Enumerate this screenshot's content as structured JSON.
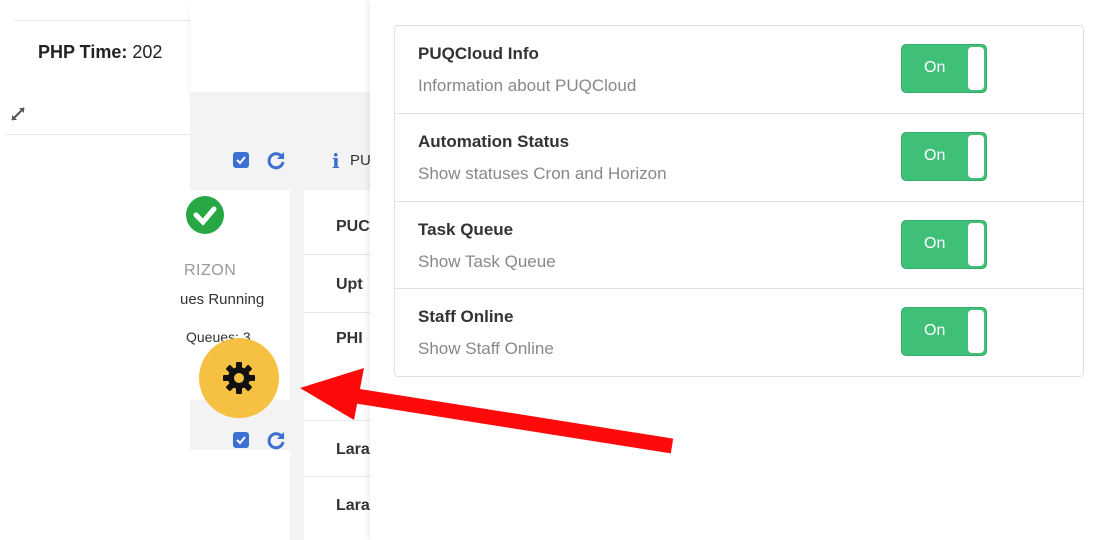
{
  "php_card": {
    "label": "PHP Time:",
    "value": "202"
  },
  "horizon_widget": {
    "status_title": "RIZON",
    "running_text": "ues Running",
    "queues_text": "Queues: 3"
  },
  "info_widget": {
    "header": "PU",
    "rows": [
      "PUC",
      "Upt",
      "PHI",
      "Lara",
      "Lara"
    ]
  },
  "settings": {
    "items": [
      {
        "title": "PUQCloud Info",
        "description": "Information about PUQCloud",
        "toggle": "On"
      },
      {
        "title": "Automation Status",
        "description": "Show statuses Cron and Horizon",
        "toggle": "On"
      },
      {
        "title": "Task Queue",
        "description": "Show Task Queue",
        "toggle": "On"
      },
      {
        "title": "Staff Online",
        "description": "Show Staff Online",
        "toggle": "On"
      }
    ]
  },
  "colors": {
    "toggle_on": "#3fbf77",
    "gear_button": "#f6c142",
    "arrow": "#ff0000",
    "checkbox": "#3b6fd1"
  },
  "icons": [
    "expand-icon",
    "checkbox-icon",
    "refresh-icon",
    "check-circle-icon",
    "info-icon",
    "gear-icon",
    "arrow-annotation"
  ]
}
